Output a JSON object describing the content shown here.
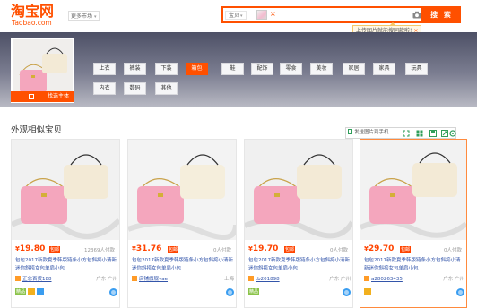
{
  "header": {
    "logo_cn": "淘宝网",
    "logo_en": "Taobao.com",
    "market_label": "更多市场",
    "search_scope": "宝贝",
    "search_clear": "×",
    "search_button": "搜 索",
    "tip_text": "上传图片就能搜同款啦!",
    "tip_close": "×"
  },
  "banner": {
    "source_tag": "找选主体",
    "categories": [
      "上衣",
      "裤装",
      "下装",
      "箱包",
      "鞋",
      "配饰",
      "零食",
      "美妆",
      "家居",
      "家具",
      "玩具",
      "内衣",
      "数码",
      "其他"
    ],
    "active_category": "箱包"
  },
  "section": {
    "title": "外观相似宝贝",
    "toolbar_label": "发送图片到手机"
  },
  "items": [
    {
      "price": "19.80",
      "badge": "包邮",
      "sales": "12369人付款",
      "title": "包包2017新款夏季韩版链条小方包斜挎小清新迷你斜挎女包单肩小包",
      "shop": "正念百货188",
      "location": "广东 广州",
      "tag": "精品"
    },
    {
      "price": "31.76",
      "badge": "包邮",
      "sales": "0人付款",
      "title": "包包2017新款夏季韩版链条小方包斜挎小清新迷你斜挎女包单肩小包",
      "shop": "店铺旗舰vae",
      "location": "上海",
      "tag": ""
    },
    {
      "price": "19.70",
      "badge": "包邮",
      "sales": "0人付款",
      "title": "包包2017新款夏季韩版链条小方包斜挎小清新迷你斜挎女包单肩小包",
      "shop": "tb201898",
      "location": "广东 广州",
      "tag": "精品"
    },
    {
      "price": "29.70",
      "badge": "包邮",
      "sales": "0人付款",
      "title": "包包2017新款夏季韩版链条小方包斜挎小清新迷你斜挎女包单肩小包",
      "shop": "a280263435",
      "location": "广东 广州",
      "tag": ""
    }
  ],
  "currency": "¥",
  "colors": {
    "brand": "#ff5000",
    "price": "#ff4400",
    "link": "#3355aa"
  },
  "icons": [
    "camera-icon",
    "edit-icon",
    "phone-icon",
    "expand-icon",
    "grid-icon",
    "save-icon",
    "share-icon",
    "settings-icon",
    "chevron-down-icon",
    "wangwang-icon"
  ]
}
